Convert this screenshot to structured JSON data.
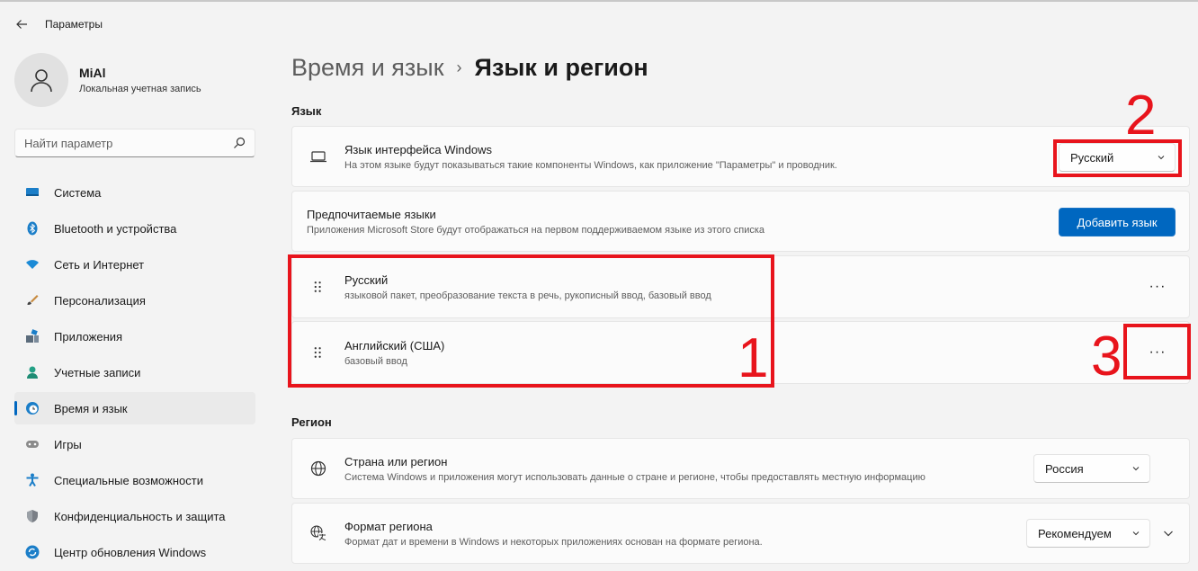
{
  "app": {
    "title": "Параметры"
  },
  "profile": {
    "name": "MiAl",
    "account_type": "Локальная учетная запись"
  },
  "search": {
    "placeholder": "Найти параметр"
  },
  "nav": [
    {
      "label": "Система",
      "icon": "monitor-icon"
    },
    {
      "label": "Bluetooth и устройства",
      "icon": "bluetooth-icon"
    },
    {
      "label": "Сеть и Интернет",
      "icon": "wifi-icon"
    },
    {
      "label": "Персонализация",
      "icon": "brush-icon"
    },
    {
      "label": "Приложения",
      "icon": "apps-icon"
    },
    {
      "label": "Учетные записи",
      "icon": "person-icon"
    },
    {
      "label": "Время и язык",
      "icon": "globe-clock-icon",
      "active": true
    },
    {
      "label": "Игры",
      "icon": "gamepad-icon"
    },
    {
      "label": "Специальные возможности",
      "icon": "accessibility-icon"
    },
    {
      "label": "Конфиденциальность и защита",
      "icon": "shield-icon"
    },
    {
      "label": "Центр обновления Windows",
      "icon": "update-icon"
    }
  ],
  "breadcrumb": {
    "parent": "Время и язык",
    "current": "Язык и регион"
  },
  "language_section": {
    "heading": "Язык",
    "display_language": {
      "title": "Язык интерфейса Windows",
      "subtitle": "На этом языке будут показываться такие компоненты Windows, как приложение \"Параметры\" и проводник.",
      "value": "Русский"
    },
    "preferred": {
      "title": "Предпочитаемые языки",
      "subtitle": "Приложения Microsoft Store будут отображаться на первом поддерживаемом языке из этого списка",
      "button": "Добавить язык"
    },
    "languages": [
      {
        "name": "Русский",
        "features": "языковой пакет, преобразование текста в речь, рукописный ввод, базовый ввод",
        "more": "···"
      },
      {
        "name": "Английский (США)",
        "features": "базовый ввод",
        "more": "···"
      }
    ]
  },
  "region_section": {
    "heading": "Регион",
    "country": {
      "title": "Страна или регион",
      "subtitle": "Система Windows и приложения могут использовать данные о стране и регионе, чтобы предоставлять местную информацию",
      "value": "Россия"
    },
    "format": {
      "title": "Формат региона",
      "subtitle": "Формат дат и времени в Windows и некоторых приложениях основан на формате региона.",
      "value": "Рекомендуем"
    }
  },
  "annotations": {
    "num1": "1",
    "num2": "2",
    "num3": "3",
    "color": "#e8141c"
  },
  "colors": {
    "accent": "#0067c0",
    "background": "#f3f3f3",
    "card": "#fbfbfb"
  }
}
